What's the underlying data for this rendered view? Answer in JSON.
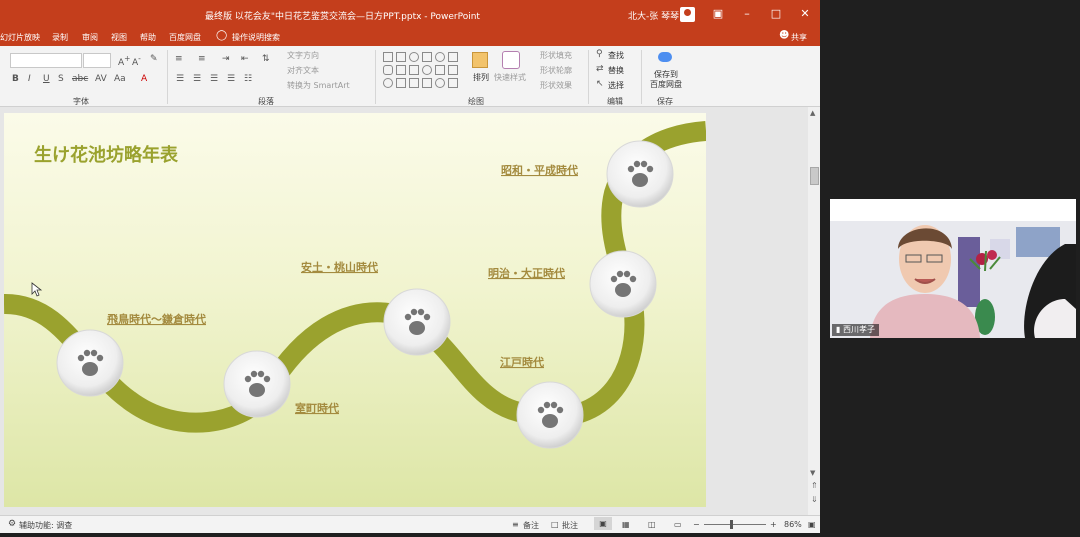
{
  "window": {
    "title": "最终版  以花会友\"中日花艺鉴赏交流会—日方PPT.pptx  -  PowerPoint",
    "user_name": "北大-张 琴琴",
    "share_label": "共享"
  },
  "menu": {
    "items": [
      "幻灯片放映",
      "录制",
      "审阅",
      "视图",
      "帮助",
      "百度网盘"
    ],
    "tell_me": "操作说明搜索"
  },
  "ribbon": {
    "groups": {
      "font": "字体",
      "paragraph": "段落",
      "drawing": "绘图",
      "editing": "编辑",
      "save": "保存"
    },
    "paragraph_items": [
      "文字方向",
      "对齐文本",
      "转换为 SmartArt"
    ],
    "arrange_label": "排列",
    "quick_styles_label": "快速样式",
    "shape_items": [
      "形状填充",
      "形状轮廓",
      "形状效果"
    ],
    "find_label": "查找",
    "replace_label": "替换",
    "select_label": "选择",
    "baidu_save_label": "保存到\n百度网盘"
  },
  "slide": {
    "title": "生け花池坊略年表",
    "eras": [
      "飛鳥時代～鎌倉時代",
      "室町時代",
      "安土・桃山時代",
      "江戸時代",
      "明治・大正時代",
      "昭和・平成時代"
    ]
  },
  "status": {
    "accessibility": "辅助功能: 调查",
    "notes": "备注",
    "comments": "批注",
    "zoom": "86%"
  },
  "webcam": {
    "name": "西川孝子"
  },
  "colors": {
    "accent": "#c43e1c",
    "river": "#9aa22e",
    "era_text": "#a48b3f",
    "title_text": "#9aa22e"
  }
}
